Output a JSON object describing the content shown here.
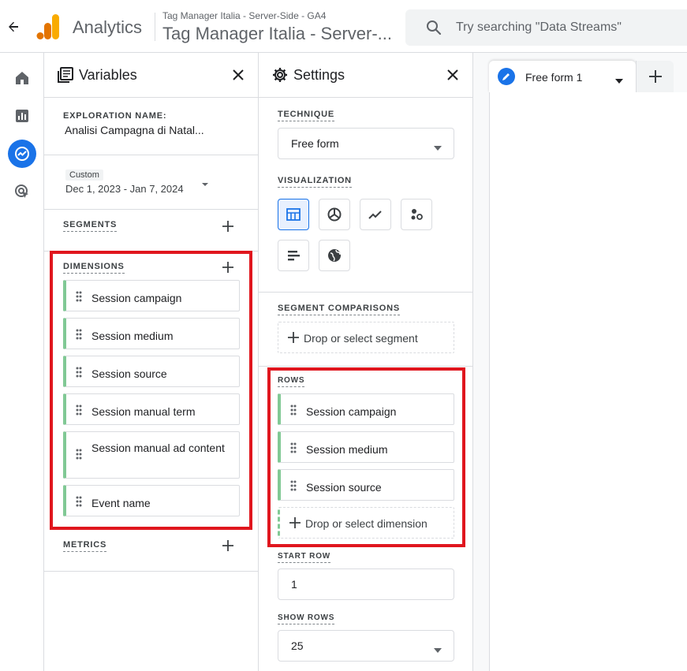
{
  "header": {
    "brand": "Analytics",
    "property_sub": "Tag Manager Italia - Server-Side - GA4",
    "property_main": "Tag Manager Italia - Server-...",
    "search_placeholder": "Try searching \"Data Streams\""
  },
  "variables": {
    "title": "Variables",
    "exploration_label": "EXPLORATION NAME:",
    "exploration_value": "Analisi Campagna di Natal...",
    "date_chip": "Custom",
    "date_range": "Dec 1, 2023 - Jan 7, 2024",
    "segments_label": "SEGMENTS",
    "dimensions_label": "DIMENSIONS",
    "dimensions": [
      "Session campaign",
      "Session medium",
      "Session source",
      "Session manual term",
      "Session manual ad content",
      "Event name"
    ],
    "metrics_label": "METRICS"
  },
  "settings": {
    "title": "Settings",
    "technique_label": "TECHNIQUE",
    "technique_value": "Free form",
    "visualization_label": "VISUALIZATION",
    "segment_comparisons_label": "SEGMENT COMPARISONS",
    "segment_drop": "Drop or select segment",
    "rows_label": "ROWS",
    "rows": [
      "Session campaign",
      "Session medium",
      "Session source"
    ],
    "rows_drop": "Drop or select dimension",
    "start_row_label": "START ROW",
    "start_row_value": "1",
    "show_rows_label": "SHOW ROWS",
    "show_rows_value": "25"
  },
  "canvas": {
    "tab_label": "Free form 1"
  },
  "colors": {
    "accent": "#1a73e8",
    "dimension_accent": "#81c995",
    "highlight_box": "#e0161e",
    "logo_orange": "#f9ab00",
    "logo_dark_orange": "#e37400"
  }
}
